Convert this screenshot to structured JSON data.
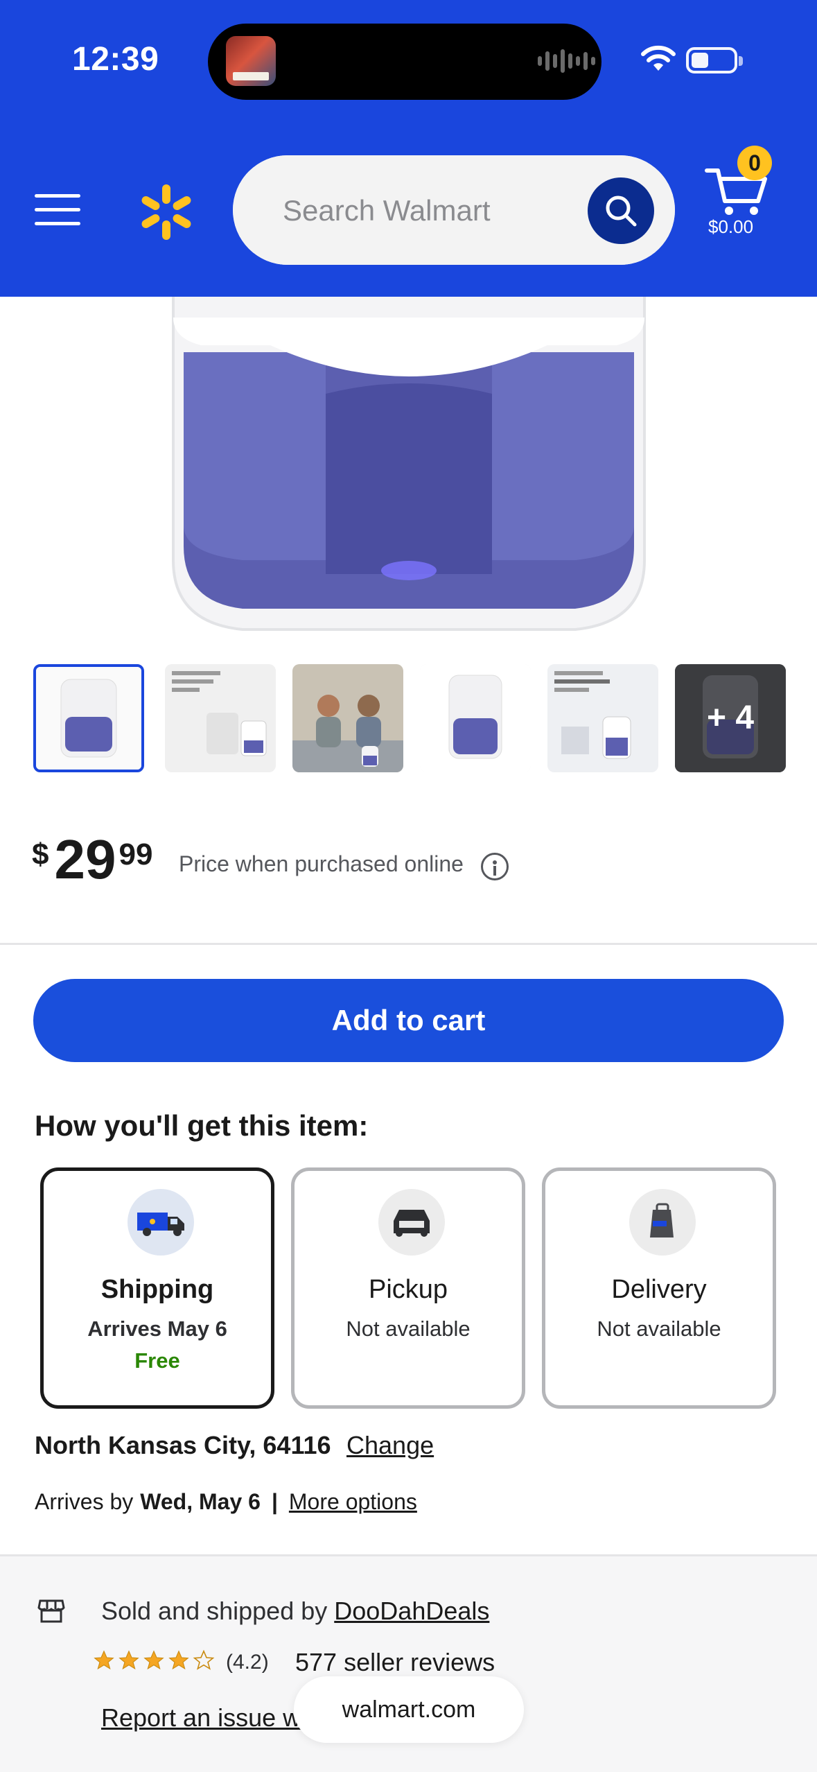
{
  "status_bar": {
    "time": "12:39"
  },
  "header": {
    "search_placeholder": "Search Walmart",
    "cart_count": "0",
    "cart_total": "$0.00"
  },
  "thumbnails": {
    "more_label": "+ 4"
  },
  "price": {
    "currency": "$",
    "dollars": "29",
    "cents": "99",
    "note": "Price when purchased online"
  },
  "add_to_cart_label": "Add to cart",
  "fulfillment": {
    "title": "How you'll get this item:",
    "options": [
      {
        "title": "Shipping",
        "sub": "Arrives May 6",
        "extra": "Free"
      },
      {
        "title": "Pickup",
        "sub": "Not available"
      },
      {
        "title": "Delivery",
        "sub": "Not available"
      }
    ]
  },
  "location": {
    "place": "North Kansas City, 64116",
    "change_label": "Change"
  },
  "arrival": {
    "prefix": "Arrives by",
    "date": "Wed, May 6",
    "separator": "|",
    "more_options": "More options"
  },
  "seller": {
    "prefix": "Sold and shipped by",
    "name": "DooDahDeals",
    "rating": "(4.2)",
    "reviews": "577 seller reviews",
    "report": "Report an issue with this seller"
  },
  "browser": {
    "url": "walmart.com"
  },
  "colors": {
    "header_blue": "#1a46dd",
    "button_blue": "#1a4fdc",
    "spark_yellow": "#ffc220",
    "free_green": "#2a8703"
  }
}
